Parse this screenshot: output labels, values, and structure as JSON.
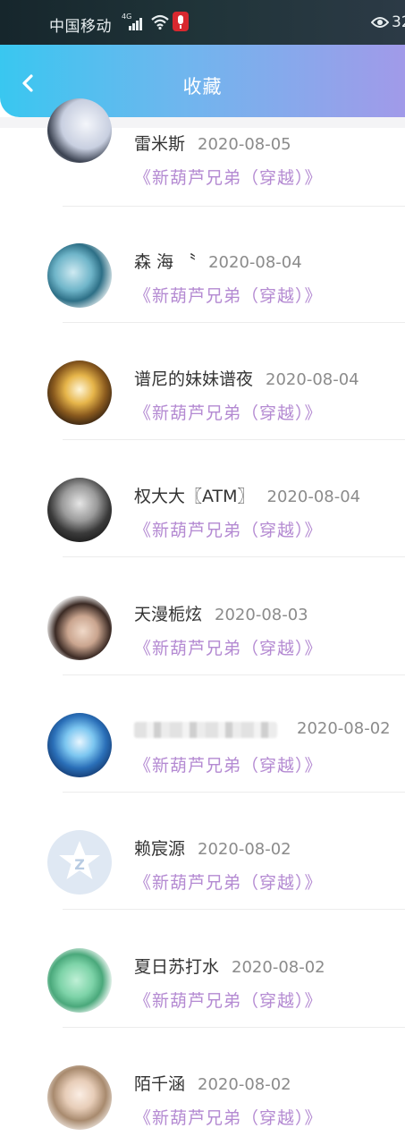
{
  "status_bar": {
    "carrier": "中国移动",
    "network_badge": "4G",
    "battery_text": "32"
  },
  "header": {
    "title": "收藏",
    "back_icon": "chevron-left-icon"
  },
  "favorites": [
    {
      "user": "雷米斯",
      "date": "2020-08-05",
      "book": "《新葫芦兄弟（穿越）》"
    },
    {
      "user": "森 海 〝",
      "date": "2020-08-04",
      "book": "《新葫芦兄弟（穿越）》"
    },
    {
      "user": "谱尼的妹妹谱夜",
      "date": "2020-08-04",
      "book": "《新葫芦兄弟（穿越）》"
    },
    {
      "user": "权大大〖ATM〗",
      "date": "2020-08-04",
      "book": "《新葫芦兄弟（穿越）》"
    },
    {
      "user": "天漫栀炫",
      "date": "2020-08-03",
      "book": "《新葫芦兄弟（穿越）》"
    },
    {
      "user": "",
      "date": "2020-08-02",
      "book": "《新葫芦兄弟（穿越）》"
    },
    {
      "user": "赖宸源",
      "date": "2020-08-02",
      "book": "《新葫芦兄弟（穿越）》"
    },
    {
      "user": "夏日苏打水",
      "date": "2020-08-02",
      "book": "《新葫芦兄弟（穿越）》"
    },
    {
      "user": "陌千涵",
      "date": "2020-08-02",
      "book": "《新葫芦兄弟（穿越）》"
    }
  ],
  "colors": {
    "header_gradient_start": "#39c7f0",
    "header_gradient_end": "#a19ae9",
    "book_title": "#b48ad2",
    "user_name": "#333333",
    "date": "#8b8b8b"
  }
}
